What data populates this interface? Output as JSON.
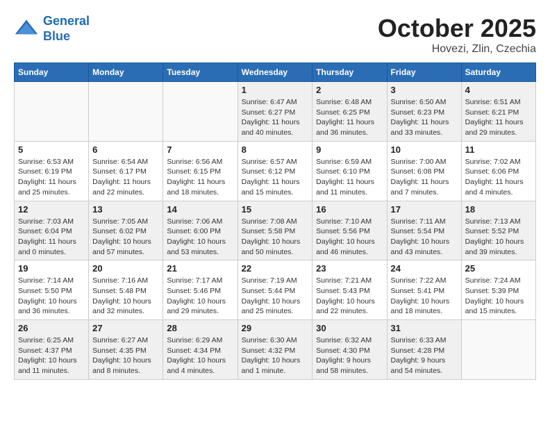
{
  "header": {
    "logo_line1": "General",
    "logo_line2": "Blue",
    "month": "October 2025",
    "location": "Hovezi, Zlin, Czechia"
  },
  "weekdays": [
    "Sunday",
    "Monday",
    "Tuesday",
    "Wednesday",
    "Thursday",
    "Friday",
    "Saturday"
  ],
  "weeks": [
    [
      {
        "day": "",
        "info": ""
      },
      {
        "day": "",
        "info": ""
      },
      {
        "day": "",
        "info": ""
      },
      {
        "day": "1",
        "info": "Sunrise: 6:47 AM\nSunset: 6:27 PM\nDaylight: 11 hours and 40 minutes."
      },
      {
        "day": "2",
        "info": "Sunrise: 6:48 AM\nSunset: 6:25 PM\nDaylight: 11 hours and 36 minutes."
      },
      {
        "day": "3",
        "info": "Sunrise: 6:50 AM\nSunset: 6:23 PM\nDaylight: 11 hours and 33 minutes."
      },
      {
        "day": "4",
        "info": "Sunrise: 6:51 AM\nSunset: 6:21 PM\nDaylight: 11 hours and 29 minutes."
      }
    ],
    [
      {
        "day": "5",
        "info": "Sunrise: 6:53 AM\nSunset: 6:19 PM\nDaylight: 11 hours and 25 minutes."
      },
      {
        "day": "6",
        "info": "Sunrise: 6:54 AM\nSunset: 6:17 PM\nDaylight: 11 hours and 22 minutes."
      },
      {
        "day": "7",
        "info": "Sunrise: 6:56 AM\nSunset: 6:15 PM\nDaylight: 11 hours and 18 minutes."
      },
      {
        "day": "8",
        "info": "Sunrise: 6:57 AM\nSunset: 6:12 PM\nDaylight: 11 hours and 15 minutes."
      },
      {
        "day": "9",
        "info": "Sunrise: 6:59 AM\nSunset: 6:10 PM\nDaylight: 11 hours and 11 minutes."
      },
      {
        "day": "10",
        "info": "Sunrise: 7:00 AM\nSunset: 6:08 PM\nDaylight: 11 hours and 7 minutes."
      },
      {
        "day": "11",
        "info": "Sunrise: 7:02 AM\nSunset: 6:06 PM\nDaylight: 11 hours and 4 minutes."
      }
    ],
    [
      {
        "day": "12",
        "info": "Sunrise: 7:03 AM\nSunset: 6:04 PM\nDaylight: 11 hours and 0 minutes."
      },
      {
        "day": "13",
        "info": "Sunrise: 7:05 AM\nSunset: 6:02 PM\nDaylight: 10 hours and 57 minutes."
      },
      {
        "day": "14",
        "info": "Sunrise: 7:06 AM\nSunset: 6:00 PM\nDaylight: 10 hours and 53 minutes."
      },
      {
        "day": "15",
        "info": "Sunrise: 7:08 AM\nSunset: 5:58 PM\nDaylight: 10 hours and 50 minutes."
      },
      {
        "day": "16",
        "info": "Sunrise: 7:10 AM\nSunset: 5:56 PM\nDaylight: 10 hours and 46 minutes."
      },
      {
        "day": "17",
        "info": "Sunrise: 7:11 AM\nSunset: 5:54 PM\nDaylight: 10 hours and 43 minutes."
      },
      {
        "day": "18",
        "info": "Sunrise: 7:13 AM\nSunset: 5:52 PM\nDaylight: 10 hours and 39 minutes."
      }
    ],
    [
      {
        "day": "19",
        "info": "Sunrise: 7:14 AM\nSunset: 5:50 PM\nDaylight: 10 hours and 36 minutes."
      },
      {
        "day": "20",
        "info": "Sunrise: 7:16 AM\nSunset: 5:48 PM\nDaylight: 10 hours and 32 minutes."
      },
      {
        "day": "21",
        "info": "Sunrise: 7:17 AM\nSunset: 5:46 PM\nDaylight: 10 hours and 29 minutes."
      },
      {
        "day": "22",
        "info": "Sunrise: 7:19 AM\nSunset: 5:44 PM\nDaylight: 10 hours and 25 minutes."
      },
      {
        "day": "23",
        "info": "Sunrise: 7:21 AM\nSunset: 5:43 PM\nDaylight: 10 hours and 22 minutes."
      },
      {
        "day": "24",
        "info": "Sunrise: 7:22 AM\nSunset: 5:41 PM\nDaylight: 10 hours and 18 minutes."
      },
      {
        "day": "25",
        "info": "Sunrise: 7:24 AM\nSunset: 5:39 PM\nDaylight: 10 hours and 15 minutes."
      }
    ],
    [
      {
        "day": "26",
        "info": "Sunrise: 6:25 AM\nSunset: 4:37 PM\nDaylight: 10 hours and 11 minutes."
      },
      {
        "day": "27",
        "info": "Sunrise: 6:27 AM\nSunset: 4:35 PM\nDaylight: 10 hours and 8 minutes."
      },
      {
        "day": "28",
        "info": "Sunrise: 6:29 AM\nSunset: 4:34 PM\nDaylight: 10 hours and 4 minutes."
      },
      {
        "day": "29",
        "info": "Sunrise: 6:30 AM\nSunset: 4:32 PM\nDaylight: 10 hours and 1 minute."
      },
      {
        "day": "30",
        "info": "Sunrise: 6:32 AM\nSunset: 4:30 PM\nDaylight: 9 hours and 58 minutes."
      },
      {
        "day": "31",
        "info": "Sunrise: 6:33 AM\nSunset: 4:28 PM\nDaylight: 9 hours and 54 minutes."
      },
      {
        "day": "",
        "info": ""
      }
    ]
  ]
}
